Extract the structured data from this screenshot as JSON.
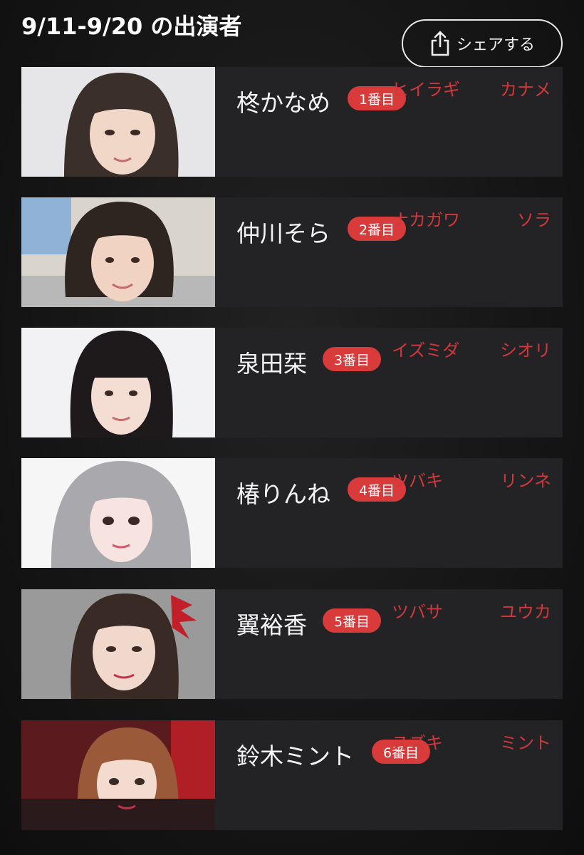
{
  "header": {
    "title": "9/11-9/20 の出演者",
    "share_label": "シェアする",
    "share_icon": "share-icon"
  },
  "colors": {
    "background": "#121212",
    "card": "#232325",
    "badge": "#d93a3a",
    "kana": "#d0393c"
  },
  "performers": [
    {
      "name": "柊かなめ",
      "order": "1番目",
      "kana_family": "ヒイラギ",
      "kana_given": "カナメ"
    },
    {
      "name": "仲川そら",
      "order": "2番目",
      "kana_family": "ナカガワ",
      "kana_given": "ソラ"
    },
    {
      "name": "泉田栞",
      "order": "3番目",
      "kana_family": "イズミダ",
      "kana_given": "シオリ"
    },
    {
      "name": "椿りんね",
      "order": "4番目",
      "kana_family": "ツバキ",
      "kana_given": "リンネ"
    },
    {
      "name": "翼裕香",
      "order": "5番目",
      "kana_family": "ツバサ",
      "kana_given": "ユウカ"
    },
    {
      "name": "鈴木ミント",
      "order": "6番目",
      "kana_family": "スズキ",
      "kana_given": "ミント"
    }
  ]
}
